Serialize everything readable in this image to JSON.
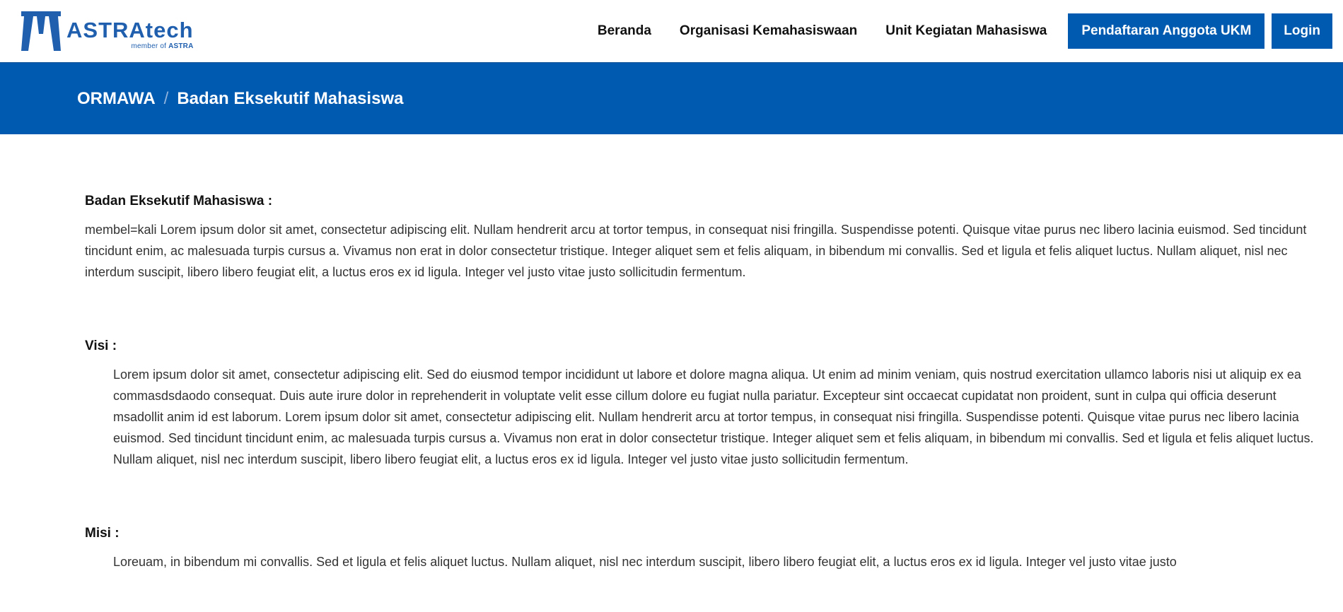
{
  "brand": {
    "name": "ASTRAtech",
    "sub_prefix": "member of",
    "sub_strong": "ASTRA"
  },
  "nav": {
    "links": [
      "Beranda",
      "Organisasi Kemahasiswaan",
      "Unit Kegiatan Mahasiswa"
    ],
    "register_label": "Pendaftaran Anggota UKM",
    "login_label": "Login"
  },
  "breadcrumb": {
    "parent": "ORMAWA",
    "separator": "/",
    "current": "Badan Eksekutif Mahasiswa"
  },
  "sections": {
    "about": {
      "title": "Badan Eksekutif Mahasiswa :",
      "text": "membel=kali Lorem ipsum dolor sit amet, consectetur adipiscing elit. Nullam hendrerit arcu at tortor tempus, in consequat nisi fringilla. Suspendisse potenti. Quisque vitae purus nec libero lacinia euismod. Sed tincidunt tincidunt enim, ac malesuada turpis cursus a. Vivamus non erat in dolor consectetur tristique. Integer aliquet sem et felis aliquam, in bibendum mi convallis. Sed et ligula et felis aliquet luctus. Nullam aliquet, nisl nec interdum suscipit, libero libero feugiat elit, a luctus eros ex id ligula. Integer vel justo vitae justo sollicitudin fermentum."
    },
    "visi": {
      "title": "Visi :",
      "text": "Lorem ipsum dolor sit amet, consectetur adipiscing elit. Sed do eiusmod tempor incididunt ut labore et dolore magna aliqua. Ut enim ad minim veniam, quis nostrud exercitation ullamco laboris nisi ut aliquip ex ea commasdsdaodo consequat. Duis aute irure dolor in reprehenderit in voluptate velit esse cillum dolore eu fugiat nulla pariatur. Excepteur sint occaecat cupidatat non proident, sunt in culpa qui officia deserunt msadollit anim id est laborum. Lorem ipsum dolor sit amet, consectetur adipiscing elit. Nullam hendrerit arcu at tortor tempus, in consequat nisi fringilla. Suspendisse potenti. Quisque vitae purus nec libero lacinia euismod. Sed tincidunt tincidunt enim, ac malesuada turpis cursus a. Vivamus non erat in dolor consectetur tristique. Integer aliquet sem et felis aliquam, in bibendum mi convallis. Sed et ligula et felis aliquet luctus. Nullam aliquet, nisl nec interdum suscipit, libero libero feugiat elit, a luctus eros ex id ligula. Integer vel justo vitae justo sollicitudin fermentum."
    },
    "misi": {
      "title": "Misi :",
      "text": "Loreuam, in bibendum mi convallis. Sed et ligula et felis aliquet luctus. Nullam aliquet, nisl nec interdum suscipit, libero libero feugiat elit, a luctus eros ex id ligula. Integer vel justo vitae justo"
    }
  },
  "colors": {
    "primary": "#005bb0",
    "brand_text": "#1f5fae"
  },
  "icons": {
    "logo": "astratech-logo-icon"
  }
}
